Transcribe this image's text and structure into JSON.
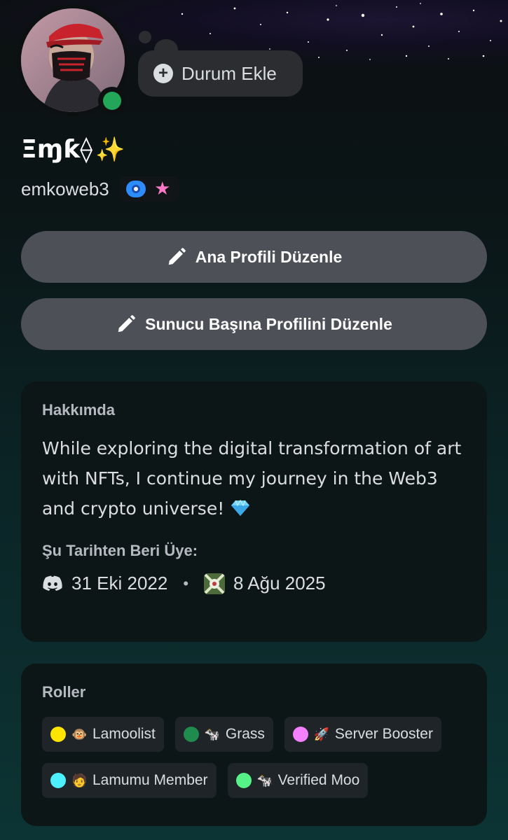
{
  "profile": {
    "display_name": "Ξɱƙ⟠",
    "display_name_emoji": "✨",
    "username": "emkoweb3",
    "status_online_color": "#23a55a",
    "status_button_label": "Durum Ekle",
    "badges": [
      "nitro-boost-badge",
      "star-badge"
    ]
  },
  "buttons": {
    "edit_main_profile": "Ana Profili Düzenle",
    "edit_server_profile": "Sunucu Başına Profilini Düzenle"
  },
  "about": {
    "heading": "Hakkımda",
    "bio": "While exploring the digital transformation of art with NFTs, I continue my journey in the Web3 and crypto universe!",
    "bio_emoji": "gem-icon",
    "member_since_heading": "Şu Tarihten Beri Üye:",
    "discord_date": "31 Eki 2022",
    "separator": "•",
    "server_date": "8 Ağu 2025"
  },
  "roles": {
    "heading": "Roller",
    "items": [
      {
        "name": "Lamoolist",
        "color": "#ffe500",
        "emoji": "🐵"
      },
      {
        "name": "Grass",
        "color": "#1f8b4c",
        "emoji": "🐄"
      },
      {
        "name": "Server Booster",
        "color": "#f47fff",
        "emoji": "🚀"
      },
      {
        "name": "Lamumu Member",
        "color": "#4ef0ff",
        "emoji": "🧑"
      },
      {
        "name": "Verified Moo",
        "color": "#57f287",
        "emoji": "🐄"
      }
    ]
  }
}
